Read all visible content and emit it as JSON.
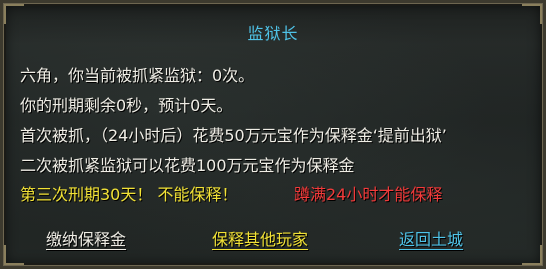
{
  "dialog": {
    "title": "监狱长",
    "lines": [
      "六角，你当前被抓紧监狱：0次。",
      "你的刑期剩余0秒，预计0天。",
      "首次被抓，（24小时后）花费50万元宝作为保释金‘提前出狱’",
      "二次被抓紧监狱可以花费100万元宝作为保释金"
    ],
    "warning_yellow": "第三次刑期30天！ 不能保释！",
    "warning_red": "蹲满24小时才能保释",
    "actions": {
      "pay_bail": "缴纳保释金",
      "bail_others": "保释其他玩家",
      "return_city": "返回土城"
    },
    "colors": {
      "title": "#4fc3e8",
      "body_text": "#f0eee6",
      "yellow": "#f2e236",
      "red": "#f23a3a"
    }
  }
}
